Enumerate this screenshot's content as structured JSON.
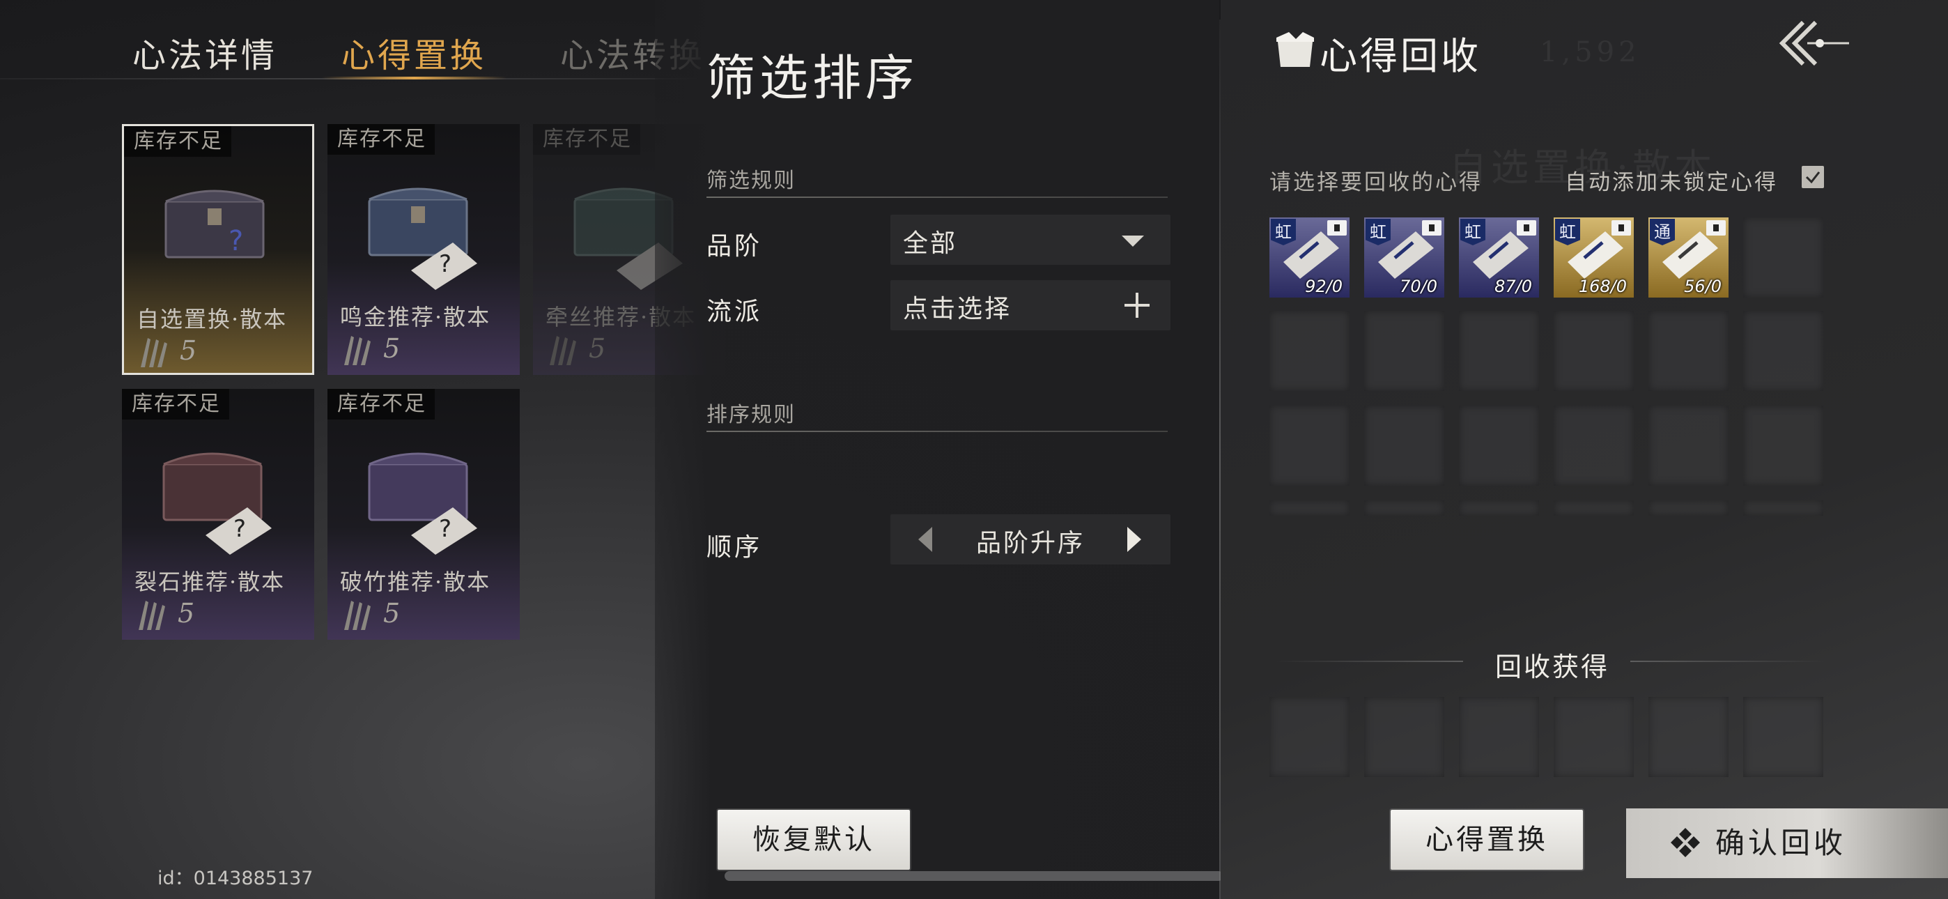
{
  "tabs": [
    {
      "label": "心法详情",
      "state": "normal"
    },
    {
      "label": "心得置换",
      "state": "active"
    },
    {
      "label": "心法转换",
      "state": "obscured"
    }
  ],
  "cards": [
    {
      "stock": "库存不足",
      "name": "自选置换·散本",
      "count": "5",
      "selected": true,
      "color": "#6e5a2e"
    },
    {
      "stock": "库存不足",
      "name": "鸣金推荐·散本",
      "count": "5",
      "selected": false,
      "color": "#413555"
    },
    {
      "stock": "库存不足",
      "name": "牵丝推荐·散本",
      "count": "5",
      "selected": false,
      "color": "#413555"
    },
    {
      "stock": "库存不足",
      "name": "裂石推荐·散本",
      "count": "5",
      "selected": false,
      "color": "#413555"
    },
    {
      "stock": "库存不足",
      "name": "破竹推荐·散本",
      "count": "5",
      "selected": false,
      "color": "#413555"
    }
  ],
  "footer": {
    "id_label": "id：0143885137"
  },
  "filter_panel": {
    "title": "筛选排序",
    "filter_rules_label": "筛选规则",
    "grade_label": "品阶",
    "grade_value": "全部",
    "school_label": "流派",
    "school_value": "点击选择",
    "sort_rules_label": "排序规则",
    "order_label": "顺序",
    "order_value": "品阶升序",
    "reset_button": "恢复默认"
  },
  "recycle_panel": {
    "title": "心得回收",
    "select_prompt": "请选择要回收的心得",
    "auto_add_label": "自动添加未锁定心得",
    "auto_add_checked": true,
    "items": [
      {
        "grade": "虹",
        "qty": "92/0",
        "rarity": "purple"
      },
      {
        "grade": "虹",
        "qty": "70/0",
        "rarity": "purple"
      },
      {
        "grade": "虹",
        "qty": "87/0",
        "rarity": "purple"
      },
      {
        "grade": "虹",
        "qty": "168/0",
        "rarity": "gold"
      },
      {
        "grade": "通",
        "qty": "56/0",
        "rarity": "gold"
      }
    ],
    "gain_label": "回收获得",
    "exchange_button": "心得置换",
    "confirm_button": "确认回收"
  },
  "colors": {
    "accent_gold": "#e0a64e",
    "panel_dark": "#1f1f21",
    "button_light": "#f4f3f0",
    "rarity_purple": "#6a6a98",
    "rarity_gold": "#d4b870"
  },
  "icons": [
    "chest-icon",
    "manual-book-icon",
    "fragment-icon",
    "chevron-down-icon",
    "plus-icon",
    "arrow-left-icon",
    "arrow-right-icon",
    "recycle-box-icon",
    "back-arrow-icon",
    "checkmark-icon",
    "lock-icon",
    "diamond-icon"
  ]
}
